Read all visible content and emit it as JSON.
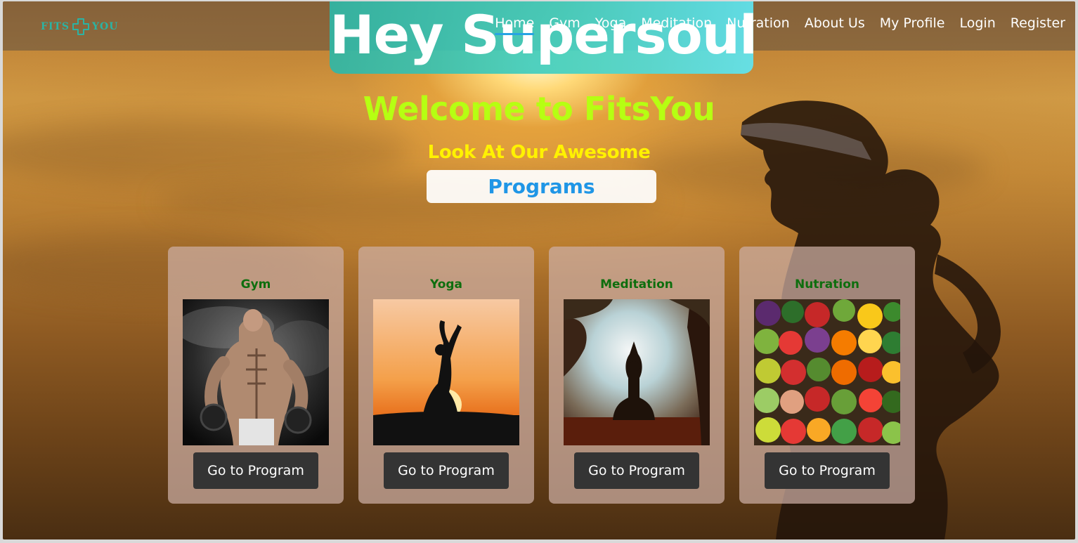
{
  "brand": {
    "logo_left": "FITS",
    "logo_right": "YOU",
    "accent_color": "#2bb3a3"
  },
  "hero": {
    "title": "Hey Supersoul"
  },
  "nav": {
    "items": [
      {
        "label": "Home",
        "active": true
      },
      {
        "label": "Gym"
      },
      {
        "label": "Yoga"
      },
      {
        "label": "Meditation"
      },
      {
        "label": "Nutration"
      },
      {
        "label": "About Us"
      },
      {
        "label": "My Profile"
      },
      {
        "label": "Login"
      },
      {
        "label": "Register"
      }
    ],
    "active_underline_color": "#27a3e3"
  },
  "main": {
    "welcome": "Welcome to FitsYou",
    "subtitle": "Look At Our Awesome",
    "programs_label": "Programs",
    "welcome_color": "#b6ff12",
    "subtitle_color": "#fff200",
    "programs_color": "#1f96e6"
  },
  "cards": [
    {
      "title": "Gym",
      "image": "bodybuilder-with-dumbbells",
      "button": "Go to Program"
    },
    {
      "title": "Yoga",
      "image": "yoga-silhouette-sunset",
      "button": "Go to Program"
    },
    {
      "title": "Meditation",
      "image": "meditation-silhouette-sunrise",
      "button": "Go to Program"
    },
    {
      "title": "Nutration",
      "image": "fruits-and-vegetables",
      "button": "Go to Program"
    }
  ]
}
